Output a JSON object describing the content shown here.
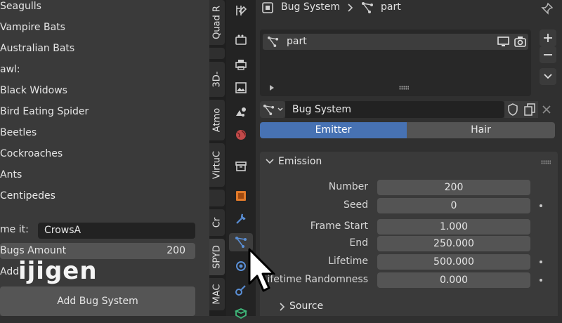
{
  "left_panel": {
    "list_items": [
      "Seagulls",
      "Vampire Bats",
      "Australian Bats",
      "awl:",
      "Black Widows",
      "Bird Eating Spider",
      "Beetles",
      "Cockroaches",
      "Ants",
      "Centipedes"
    ],
    "name_label": "me it:",
    "name_value": "CrowsA",
    "bugs_amount_label": "Bugs Amount",
    "bugs_amount_value": "200",
    "add_label": "Add ",
    "add_bug_system_label": "Add Bug System",
    "watermark": "ijigen"
  },
  "vertical_tabs": [
    "Quad R",
    "3D-",
    "Atmo",
    "VirtuC",
    "Cr",
    "SPYD",
    "MAC"
  ],
  "header": {
    "breadcrumb_1": "Bug System",
    "breadcrumb_2": "part"
  },
  "system_list": {
    "items": [
      "part"
    ]
  },
  "settings_selector": {
    "name": "Bug System"
  },
  "type_toggle": {
    "emitter": "Emitter",
    "hair": "Hair",
    "active": "Emitter"
  },
  "emission": {
    "title": "Emission",
    "fields": [
      {
        "label": "Number",
        "value": "200"
      },
      {
        "label": "Seed",
        "value": "0"
      },
      {
        "label": "Frame Start",
        "value": "1.000"
      },
      {
        "label": "End",
        "value": "250.000"
      },
      {
        "label": "Lifetime",
        "value": "500.000"
      },
      {
        "label": "Lifetime Randomness",
        "value": "0.000"
      }
    ]
  },
  "source": {
    "title": "Source"
  },
  "colors": {
    "accent": "#4772b3",
    "panel": "#3a3a3a",
    "field": "#545454"
  }
}
